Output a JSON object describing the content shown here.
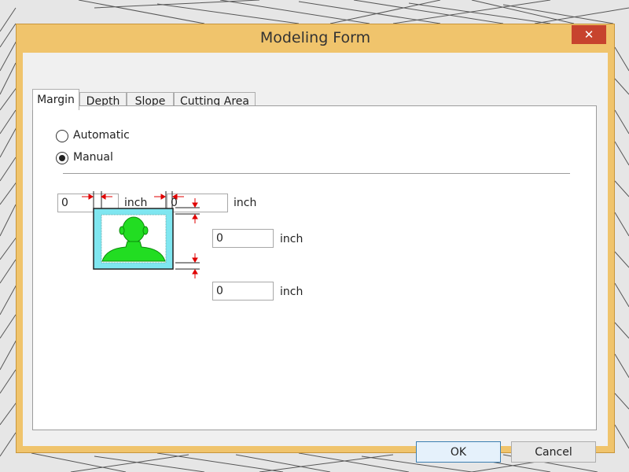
{
  "window": {
    "title": "Modeling Form",
    "close_glyph": "✕"
  },
  "tabs": [
    {
      "label": "Margin",
      "active": true
    },
    {
      "label": "Depth",
      "active": false
    },
    {
      "label": "Slope",
      "active": false
    },
    {
      "label": "Cutting Area",
      "active": false
    }
  ],
  "margin": {
    "mode_options": [
      {
        "label": "Automatic",
        "checked": false
      },
      {
        "label": "Manual",
        "checked": true
      }
    ],
    "fields": {
      "left": {
        "value": "0",
        "unit": "inch"
      },
      "right": {
        "value": "0",
        "unit": "inch"
      },
      "top": {
        "value": "0",
        "unit": "inch"
      },
      "bottom": {
        "value": "0",
        "unit": "inch"
      }
    }
  },
  "buttons": {
    "ok": "OK",
    "cancel": "Cancel"
  },
  "icons": {
    "close": "close-icon",
    "diagram": "margin-diagram-icon"
  },
  "colors": {
    "window_frame": "#f0c46c",
    "close_button": "#c7432e",
    "arrow": "#e00000",
    "figure": "#22dd22",
    "figure_bg": "#7fe6f0"
  }
}
